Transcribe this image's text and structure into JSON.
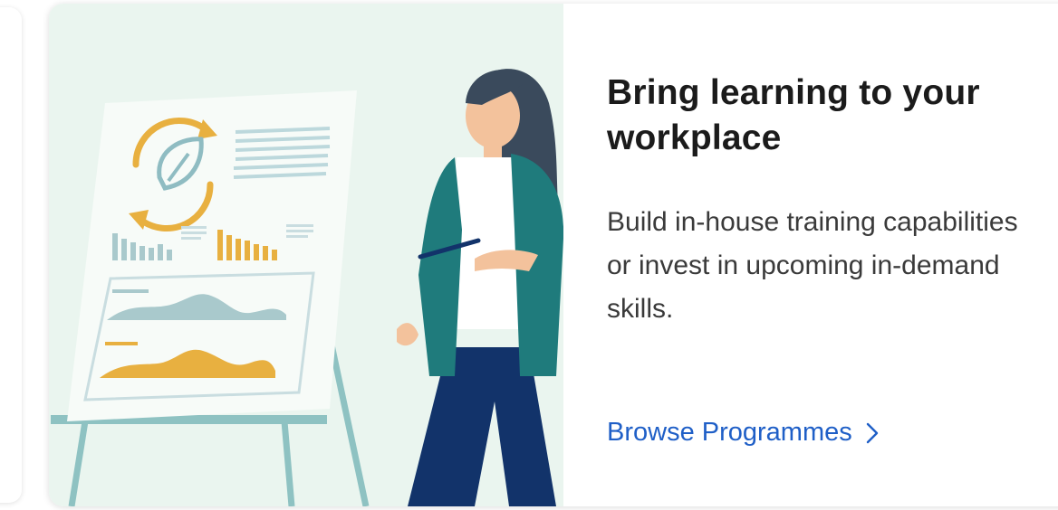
{
  "card": {
    "title": "Bring learning to your workplace",
    "description": "Build in-house training capabilities or invest in upcoming in-demand skills.",
    "cta_label": "Browse Programmes",
    "cta_icon": "chevron-right-icon"
  },
  "illustration": {
    "subject": "woman-presenting-whiteboard-illustration",
    "icon": "leaf-cycle-icon"
  },
  "colors": {
    "accent": "#1f5fc7",
    "title": "#1b1b1b",
    "text": "#3a3a3a",
    "illustration_bg": "#eaf5ef",
    "gold": "#e8b040",
    "teal": "#1f7b7c",
    "navy": "#12336a"
  }
}
